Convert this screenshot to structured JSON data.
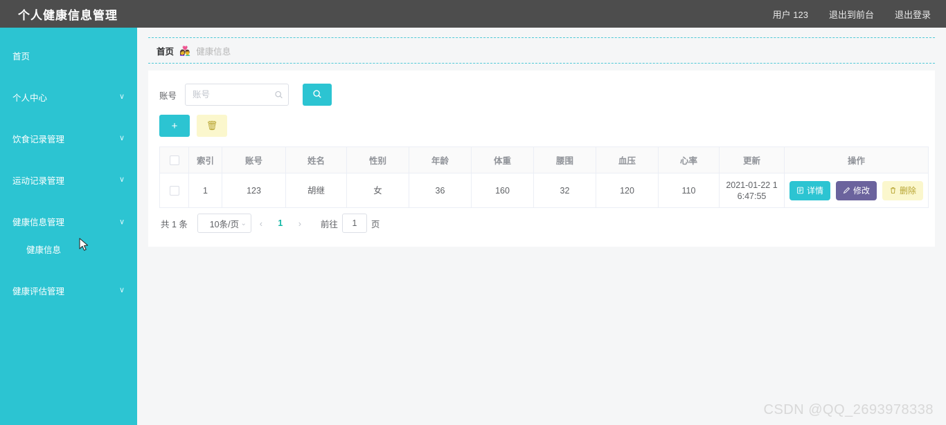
{
  "header": {
    "title": "个人健康信息管理",
    "nav": [
      {
        "label": "用户 123",
        "name": "user-name"
      },
      {
        "label": "退出到前台",
        "name": "exit-to-frontend"
      },
      {
        "label": "退出登录",
        "name": "logout"
      }
    ]
  },
  "sidebar": {
    "items": [
      {
        "label": "首页",
        "caret": "",
        "sub": false
      },
      {
        "label": "个人中心",
        "caret": "∨",
        "sub": false
      },
      {
        "label": "饮食记录管理",
        "caret": "∨",
        "sub": false
      },
      {
        "label": "运动记录管理",
        "caret": "∨",
        "sub": false
      },
      {
        "label": "健康信息管理",
        "caret": "∧",
        "sub": false
      },
      {
        "label": "健康信息",
        "caret": "",
        "sub": true
      },
      {
        "label": "健康评估管理",
        "caret": "∨",
        "sub": false
      }
    ]
  },
  "breadcrumb": {
    "home": "首页",
    "separator": "👩‍❤️‍👨",
    "current": "健康信息"
  },
  "search": {
    "label": "账号",
    "placeholder": "账号",
    "value": "",
    "button_icon": "search-icon"
  },
  "toolbar": {
    "add_label": "+",
    "delete_label": "🗑"
  },
  "table": {
    "columns": [
      "",
      "索引",
      "账号",
      "姓名",
      "性别",
      "年龄",
      "体重",
      "腰围",
      "血压",
      "心率",
      "更新",
      "操作"
    ],
    "rows": [
      {
        "index": "1",
        "account": "123",
        "name": "胡继",
        "gender": "女",
        "age": "36",
        "weight": "160",
        "waist": "32",
        "blood_pressure": "120",
        "heart_rate": "110",
        "updated": "2021-01-22 16:47:55"
      }
    ],
    "row_actions": {
      "detail": "详情",
      "edit": "修改",
      "delete": "删除",
      "detail_icon": "document-icon",
      "edit_icon": "pencil-icon",
      "delete_icon": "trash-icon"
    }
  },
  "pagination": {
    "total": "共 1 条",
    "page_size": "10条/页",
    "prev": "‹",
    "next": "›",
    "current_page": "1",
    "goto_label": "前往",
    "goto_value": "1",
    "page_unit": "页"
  },
  "watermark": "CSDN @QQ_2693978338",
  "colors": {
    "brand_teal": "#2cc4d2",
    "header_dark": "#4d4d4d",
    "edit_purple": "#6b639d",
    "delete_yellow": "#fbf7cd",
    "page_active": "#15b8a6"
  }
}
